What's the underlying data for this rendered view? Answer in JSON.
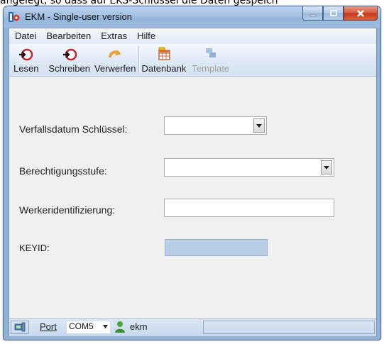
{
  "background_text": "angelegt, so dass auf EKS-Schlüssel die Daten gespeich",
  "window": {
    "title": "EKM - Single-user version"
  },
  "menu": {
    "items": [
      "Datei",
      "Bearbeiten",
      "Extras",
      "Hilfe"
    ]
  },
  "toolbar": {
    "lesen": "Lesen",
    "schreiben": "Schreiben",
    "verwerfen": "Verwerfen",
    "datenbank": "Datenbank",
    "template": "Template"
  },
  "form": {
    "verfallsdatum_label": "Verfallsdatum Schlüssel:",
    "verfallsdatum_value": "",
    "berechtigung_label": "Berechtigungsstufe:",
    "berechtigung_value": "",
    "werker_label": "Werkeridentifizierung:",
    "werker_value": "",
    "keyid_label": "KEYID:",
    "keyid_value": ""
  },
  "statusbar": {
    "port_label": "Port",
    "port_value": "COM5",
    "user": "ekm"
  },
  "colors": {
    "accent": "#8fb2d6",
    "keyid_field": "#b9cfe6",
    "close_button": "#c4361a"
  }
}
